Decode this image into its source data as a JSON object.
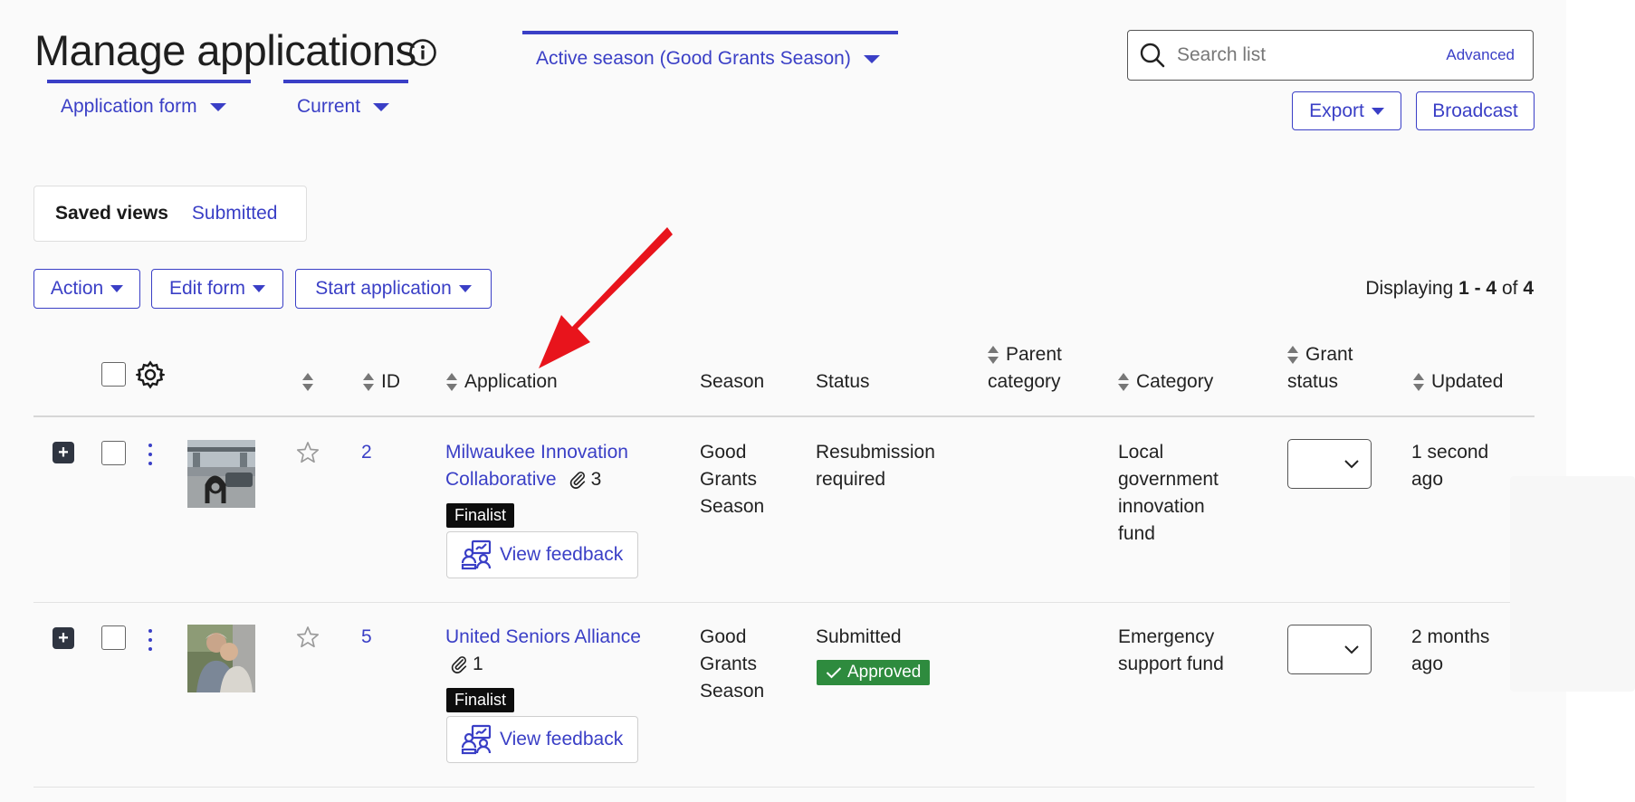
{
  "header": {
    "title": "Manage applications",
    "filters": {
      "application_form": "Application form",
      "current": "Current",
      "season": "Active season (Good Grants Season)"
    },
    "search": {
      "placeholder": "Search list",
      "advanced": "Advanced"
    },
    "export_label": "Export",
    "broadcast_label": "Broadcast"
  },
  "saved_views": {
    "label": "Saved views",
    "submitted": "Submitted"
  },
  "toolbar": {
    "action": "Action",
    "edit_form": "Edit form",
    "start_application": "Start application",
    "displaying_prefix": "Displaying ",
    "displaying_range": "1 - 4",
    "displaying_of": " of ",
    "displaying_total": "4"
  },
  "table": {
    "columns": {
      "id": "ID",
      "application": "Application",
      "season": "Season",
      "status": "Status",
      "parent_category_1": "Parent",
      "parent_category_2": "category",
      "category": "Category",
      "grant_status_1": "Grant",
      "grant_status_2": "status",
      "updated": "Updated"
    },
    "rows": [
      {
        "id": "2",
        "app_line1": "Milwaukee Innovation",
        "app_line2": "Collaborative",
        "attachments": "3",
        "badge": "Finalist",
        "feedback": "View feedback",
        "season_1": "Good",
        "season_2": "Grants",
        "season_3": "Season",
        "status_1": "Resubmission",
        "status_2": "required",
        "category_1": "Local",
        "category_2": "government",
        "category_3": "innovation",
        "category_4": "fund",
        "updated_1": "1 second",
        "updated_2": "ago"
      },
      {
        "id": "5",
        "app_line1": "United Seniors Alliance",
        "attachments": "1",
        "badge": "Finalist",
        "feedback": "View feedback",
        "season_1": "Good",
        "season_2": "Grants",
        "season_3": "Season",
        "status_1": "Submitted",
        "status_badge": "Approved",
        "category_1": "Emergency",
        "category_2": "support fund",
        "updated_1": "2 months",
        "updated_2": "ago"
      }
    ]
  },
  "colors": {
    "accent": "#3a3fc6",
    "approved": "#2e8b3e",
    "annotation_arrow": "#e8141c"
  }
}
